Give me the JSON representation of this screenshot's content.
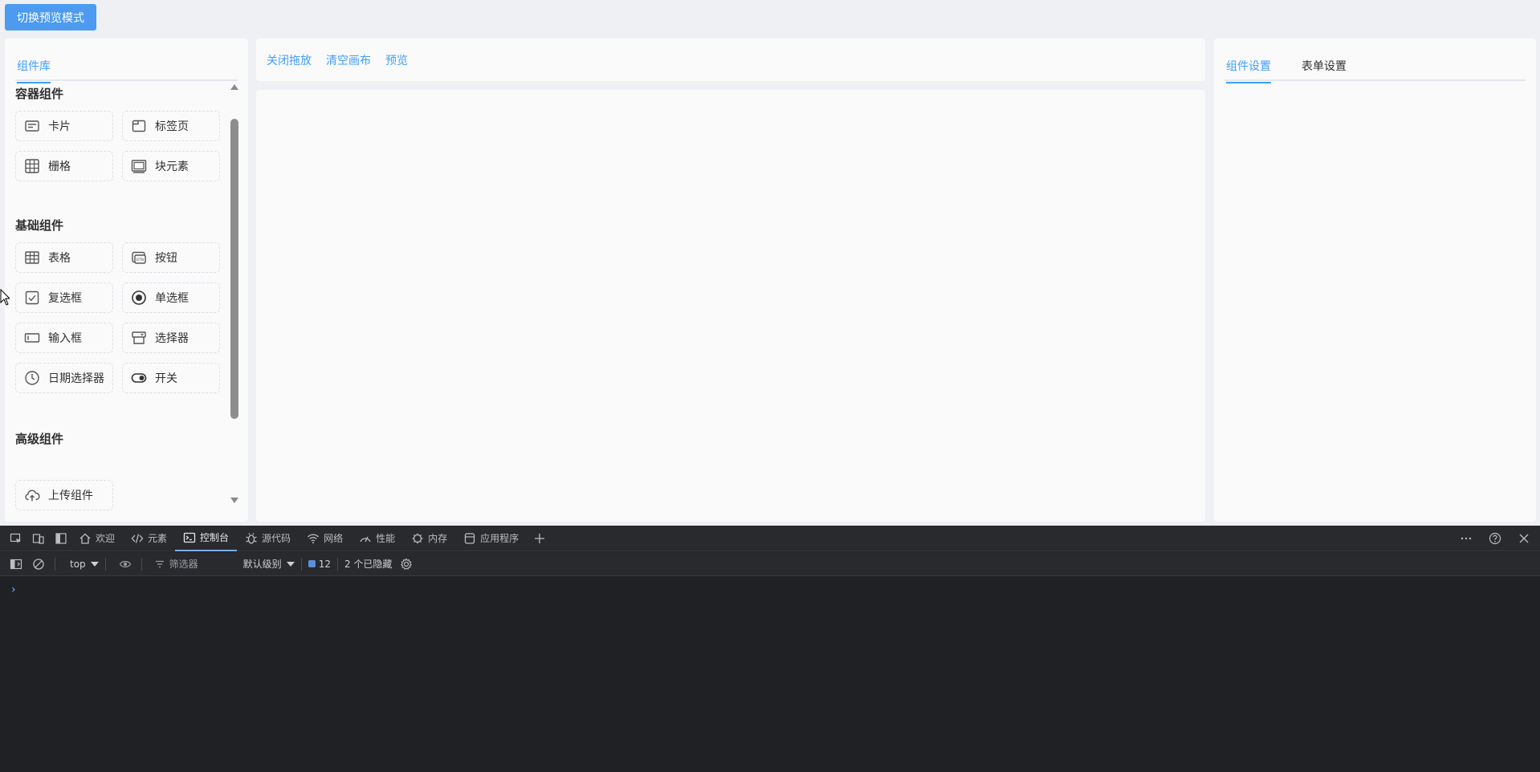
{
  "app": {
    "mode_toggle_label": "切换预览模式"
  },
  "left_panel": {
    "tab_label": "组件库",
    "groups": [
      {
        "title": "容器组件",
        "items": [
          {
            "label": "卡片",
            "icon": "card-icon"
          },
          {
            "label": "标签页",
            "icon": "tabs-icon"
          },
          {
            "label": "栅格",
            "icon": "grid-icon"
          },
          {
            "label": "块元素",
            "icon": "block-icon"
          }
        ]
      },
      {
        "title": "基础组件",
        "items": [
          {
            "label": "表格",
            "icon": "table-icon"
          },
          {
            "label": "按钮",
            "icon": "button-icon"
          },
          {
            "label": "复选框",
            "icon": "checkbox-icon"
          },
          {
            "label": "单选框",
            "icon": "radio-icon"
          },
          {
            "label": "输入框",
            "icon": "input-icon"
          },
          {
            "label": "选择器",
            "icon": "select-icon"
          },
          {
            "label": "日期选择器",
            "icon": "clock-icon"
          },
          {
            "label": "开关",
            "icon": "switch-icon"
          }
        ]
      },
      {
        "title": "高级组件",
        "items": [
          {
            "label": "上传组件",
            "icon": "upload-icon"
          }
        ]
      }
    ]
  },
  "toolbar": {
    "close_drag_label": "关闭拖放",
    "clear_canvas_label": "清空画布",
    "preview_label": "预览"
  },
  "right_panel": {
    "tabs": [
      "组件设置",
      "表单设置"
    ]
  },
  "devtools": {
    "tabs": [
      {
        "label": "欢迎",
        "icon": "home-icon"
      },
      {
        "label": "元素",
        "icon": "code-icon"
      },
      {
        "label": "控制台",
        "icon": "console-icon"
      },
      {
        "label": "源代码",
        "icon": "bug-icon"
      },
      {
        "label": "网络",
        "icon": "wifi-icon"
      },
      {
        "label": "性能",
        "icon": "gauge-icon"
      },
      {
        "label": "内存",
        "icon": "chip-icon"
      },
      {
        "label": "应用程序",
        "icon": "database-icon"
      }
    ],
    "active_tab": "控制台",
    "context": "top",
    "filter_placeholder": "筛选器",
    "level": "默认级别",
    "message_count": "12",
    "hidden_text": "2 个已隐藏",
    "prompt_symbol": "›"
  }
}
